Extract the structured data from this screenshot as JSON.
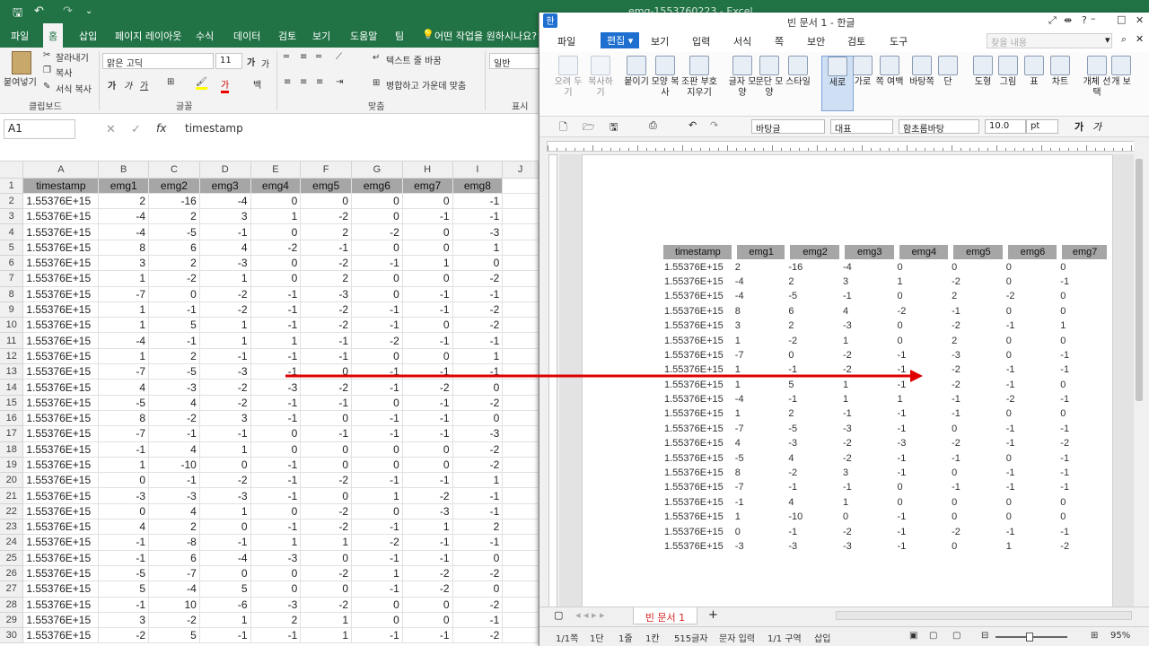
{
  "excel": {
    "title": "emg-1553760223 - Excel",
    "tabs": [
      "파일",
      "홈",
      "삽입",
      "페이지 레이아웃",
      "수식",
      "데이터",
      "검토",
      "보기",
      "도움말",
      "팀"
    ],
    "tell_me": "어떤 작업을 원하시나요?",
    "ribbon": {
      "paste": "붙여넣기",
      "cut": "잘라내기",
      "copy": "복사",
      "format_painter": "서식 복사",
      "font_name": "맑은 고딕",
      "font_size": "11",
      "wrap_text": "텍스트 줄 바꿈",
      "merge_center": "병합하고 가운데 맞춤",
      "number_format": "일반",
      "group_clipboard": "클립보드",
      "group_font": "글꼴",
      "group_align": "맞춤",
      "group_number": "표시 형"
    },
    "namebox": "A1",
    "formula": "timestamp",
    "columns": [
      "A",
      "B",
      "C",
      "D",
      "E",
      "F",
      "G",
      "H",
      "I",
      "J"
    ],
    "header_row": [
      "timestamp",
      "emg1",
      "emg2",
      "emg3",
      "emg4",
      "emg5",
      "emg6",
      "emg7",
      "emg8"
    ],
    "rows": [
      [
        "1.55376E+15",
        "2",
        "-16",
        "-4",
        "0",
        "0",
        "0",
        "0",
        "-1"
      ],
      [
        "1.55376E+15",
        "-4",
        "2",
        "3",
        "1",
        "-2",
        "0",
        "-1",
        "-1"
      ],
      [
        "1.55376E+15",
        "-4",
        "-5",
        "-1",
        "0",
        "2",
        "-2",
        "0",
        "-3"
      ],
      [
        "1.55376E+15",
        "8",
        "6",
        "4",
        "-2",
        "-1",
        "0",
        "0",
        "1"
      ],
      [
        "1.55376E+15",
        "3",
        "2",
        "-3",
        "0",
        "-2",
        "-1",
        "1",
        "0"
      ],
      [
        "1.55376E+15",
        "1",
        "-2",
        "1",
        "0",
        "2",
        "0",
        "0",
        "-2"
      ],
      [
        "1.55376E+15",
        "-7",
        "0",
        "-2",
        "-1",
        "-3",
        "0",
        "-1",
        "-1"
      ],
      [
        "1.55376E+15",
        "1",
        "-1",
        "-2",
        "-1",
        "-2",
        "-1",
        "-1",
        "-2"
      ],
      [
        "1.55376E+15",
        "1",
        "5",
        "1",
        "-1",
        "-2",
        "-1",
        "0",
        "-2"
      ],
      [
        "1.55376E+15",
        "-4",
        "-1",
        "1",
        "1",
        "-1",
        "-2",
        "-1",
        "-1"
      ],
      [
        "1.55376E+15",
        "1",
        "2",
        "-1",
        "-1",
        "-1",
        "0",
        "0",
        "1"
      ],
      [
        "1.55376E+15",
        "-7",
        "-5",
        "-3",
        "-1",
        "0",
        "-1",
        "-1",
        "-1"
      ],
      [
        "1.55376E+15",
        "4",
        "-3",
        "-2",
        "-3",
        "-2",
        "-1",
        "-2",
        "0"
      ],
      [
        "1.55376E+15",
        "-5",
        "4",
        "-2",
        "-1",
        "-1",
        "0",
        "-1",
        "-2"
      ],
      [
        "1.55376E+15",
        "8",
        "-2",
        "3",
        "-1",
        "0",
        "-1",
        "-1",
        "0"
      ],
      [
        "1.55376E+15",
        "-7",
        "-1",
        "-1",
        "0",
        "-1",
        "-1",
        "-1",
        "-3"
      ],
      [
        "1.55376E+15",
        "-1",
        "4",
        "1",
        "0",
        "0",
        "0",
        "0",
        "-2"
      ],
      [
        "1.55376E+15",
        "1",
        "-10",
        "0",
        "-1",
        "0",
        "0",
        "0",
        "-2"
      ],
      [
        "1.55376E+15",
        "0",
        "-1",
        "-2",
        "-1",
        "-2",
        "-1",
        "-1",
        "1"
      ],
      [
        "1.55376E+15",
        "-3",
        "-3",
        "-3",
        "-1",
        "0",
        "1",
        "-2",
        "-1"
      ],
      [
        "1.55376E+15",
        "0",
        "4",
        "1",
        "0",
        "-2",
        "0",
        "-3",
        "-1"
      ],
      [
        "1.55376E+15",
        "4",
        "2",
        "0",
        "-1",
        "-2",
        "-1",
        "1",
        "2"
      ],
      [
        "1.55376E+15",
        "-1",
        "-8",
        "-1",
        "1",
        "1",
        "-2",
        "-1",
        "-1"
      ],
      [
        "1.55376E+15",
        "-1",
        "6",
        "-4",
        "-3",
        "0",
        "-1",
        "-1",
        "0"
      ],
      [
        "1.55376E+15",
        "-5",
        "-7",
        "0",
        "0",
        "-2",
        "1",
        "-2",
        "-2"
      ],
      [
        "1.55376E+15",
        "5",
        "-4",
        "5",
        "0",
        "0",
        "-1",
        "-2",
        "0"
      ],
      [
        "1.55376E+15",
        "-1",
        "10",
        "-6",
        "-3",
        "-2",
        "0",
        "0",
        "-2"
      ],
      [
        "1.55376E+15",
        "3",
        "-2",
        "1",
        "2",
        "1",
        "0",
        "0",
        "-1"
      ],
      [
        "1.55376E+15",
        "-2",
        "5",
        "-1",
        "-1",
        "1",
        "-1",
        "-1",
        "-2"
      ]
    ]
  },
  "hwp": {
    "title": "빈 문서 1 - 한글",
    "menus": [
      "파일",
      "편집",
      "보기",
      "입력",
      "서식",
      "쪽",
      "보안",
      "검토",
      "도구"
    ],
    "search_placeholder": "찾을 내용",
    "tools": [
      "오려 두기",
      "복사하기",
      "붙이기",
      "모양 복사",
      "조판 부호 지우기",
      "글자 모양",
      "문단 모양",
      "스타일",
      "세로",
      "가로",
      "쪽 여백",
      "바탕쪽",
      "단",
      "도형",
      "그림",
      "표",
      "차트",
      "개체 선택",
      "개 보"
    ],
    "style_box": "바탕글",
    "para_box": "대표",
    "font_box": "함초롬바탕",
    "size_box": "10.0",
    "size_unit": "pt",
    "header_row": [
      "timestamp",
      "emg1",
      "emg2",
      "emg3",
      "emg4",
      "emg5",
      "emg6",
      "emg7"
    ],
    "rows": [
      [
        "1.55376E+15",
        "2",
        "-16",
        "-4",
        "0",
        "0",
        "0",
        "0"
      ],
      [
        "1.55376E+15",
        "-4",
        "2",
        "3",
        "1",
        "-2",
        "0",
        "-1"
      ],
      [
        "1.55376E+15",
        "-4",
        "-5",
        "-1",
        "0",
        "2",
        "-2",
        "0"
      ],
      [
        "1.55376E+15",
        "8",
        "6",
        "4",
        "-2",
        "-1",
        "0",
        "0"
      ],
      [
        "1.55376E+15",
        "3",
        "2",
        "-3",
        "0",
        "-2",
        "-1",
        "1"
      ],
      [
        "1.55376E+15",
        "1",
        "-2",
        "1",
        "0",
        "2",
        "0",
        "0"
      ],
      [
        "1.55376E+15",
        "-7",
        "0",
        "-2",
        "-1",
        "-3",
        "0",
        "-1"
      ],
      [
        "1.55376E+15",
        "1",
        "-1",
        "-2",
        "-1",
        "-2",
        "-1",
        "-1"
      ],
      [
        "1.55376E+15",
        "1",
        "5",
        "1",
        "-1",
        "-2",
        "-1",
        "0"
      ],
      [
        "1.55376E+15",
        "-4",
        "-1",
        "1",
        "1",
        "-1",
        "-2",
        "-1"
      ],
      [
        "1.55376E+15",
        "1",
        "2",
        "-1",
        "-1",
        "-1",
        "0",
        "0"
      ],
      [
        "1.55376E+15",
        "-7",
        "-5",
        "-3",
        "-1",
        "0",
        "-1",
        "-1"
      ],
      [
        "1.55376E+15",
        "4",
        "-3",
        "-2",
        "-3",
        "-2",
        "-1",
        "-2"
      ],
      [
        "1.55376E+15",
        "-5",
        "4",
        "-2",
        "-1",
        "-1",
        "0",
        "-1"
      ],
      [
        "1.55376E+15",
        "8",
        "-2",
        "3",
        "-1",
        "0",
        "-1",
        "-1"
      ],
      [
        "1.55376E+15",
        "-7",
        "-1",
        "-1",
        "0",
        "-1",
        "-1",
        "-1"
      ],
      [
        "1.55376E+15",
        "-1",
        "4",
        "1",
        "0",
        "0",
        "0",
        "0"
      ],
      [
        "1.55376E+15",
        "1",
        "-10",
        "0",
        "-1",
        "0",
        "0",
        "0"
      ],
      [
        "1.55376E+15",
        "0",
        "-1",
        "-2",
        "-1",
        "-2",
        "-1",
        "-1"
      ],
      [
        "1.55376E+15",
        "-3",
        "-3",
        "-3",
        "-1",
        "0",
        "1",
        "-2"
      ]
    ],
    "doc_tab": "빈 문서 1",
    "status": [
      "1/1쪽",
      "1단",
      "1줄",
      "1칸",
      "515글자",
      "문자 입력",
      "1/1 구역",
      "삽입"
    ],
    "zoom": "95%"
  },
  "arrow_color": "#e00000"
}
